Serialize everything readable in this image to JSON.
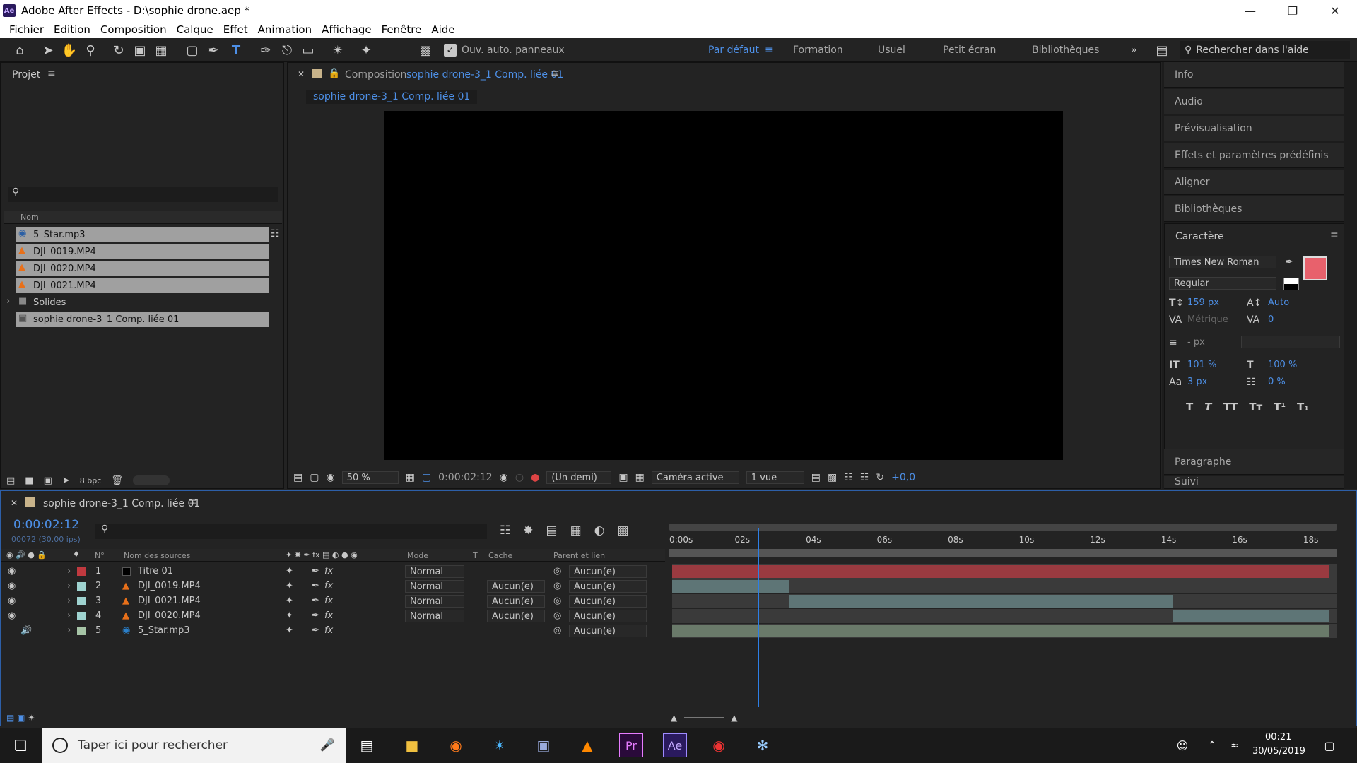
{
  "window": {
    "title": "Adobe After Effects - D:\\sophie drone.aep *",
    "app_icon": "Ae"
  },
  "menu": [
    "Fichier",
    "Edition",
    "Composition",
    "Calque",
    "Effet",
    "Animation",
    "Affichage",
    "Fenêtre",
    "Aide"
  ],
  "toolbar": {
    "auto_open_label": "Ouv. auto. panneaux",
    "workspaces": [
      "Par défaut",
      "Formation",
      "Usuel",
      "Petit écran",
      "Bibliothèques"
    ],
    "active_workspace": "Par défaut",
    "search_placeholder": "Rechercher dans l'aide"
  },
  "project": {
    "title": "Projet",
    "column_name": "Nom",
    "items": [
      {
        "name": "5_Star.mp3",
        "icon": "audio-icon",
        "selected": true
      },
      {
        "name": "DJI_0019.MP4",
        "icon": "vlc-cone-icon",
        "selected": true
      },
      {
        "name": "DJI_0020.MP4",
        "icon": "vlc-cone-icon",
        "selected": true
      },
      {
        "name": "DJI_0021.MP4",
        "icon": "vlc-cone-icon",
        "selected": true
      },
      {
        "name": "Solides",
        "icon": "folder-icon",
        "selected": false
      },
      {
        "name": "sophie drone-3_1 Comp. liée 01",
        "icon": "composition-icon",
        "selected": true
      }
    ],
    "bpc": "8 bpc"
  },
  "composition": {
    "label": "Composition",
    "name": "sophie drone-3_1 Comp. liée 01",
    "tab": "sophie drone-3_1 Comp. liée 01",
    "zoom": "50 %",
    "timecode": "0:00:02:12",
    "resolution": "(Un demi)",
    "camera": "Caméra active",
    "views": "1 vue",
    "exposure": "+0,0"
  },
  "right_panels": [
    "Info",
    "Audio",
    "Prévisualisation",
    "Effets et paramètres prédéfinis",
    "Aligner",
    "Bibliothèques"
  ],
  "character": {
    "title": "Caractère",
    "font": "Times New Roman",
    "style": "Regular",
    "size": "159 px",
    "leading": "Auto",
    "kerning": "Métrique",
    "tracking": "0",
    "line_spacing": "- px",
    "vscale": "101 %",
    "hscale": "100 %",
    "baseline": "3 px",
    "tsume": "0 %",
    "fill_color": "#e8616c",
    "style_buttons": [
      "T",
      "T",
      "TT",
      "Tт",
      "T¹",
      "T₁"
    ]
  },
  "paragraph_title": "Paragraphe",
  "suivi_title": "Suivi",
  "timeline": {
    "comp_name": "sophie drone-3_1 Comp. liée 01",
    "timecode": "0:00:02:12",
    "frames": "00072 (30.00 ips)",
    "headers": {
      "num": "N°",
      "source": "Nom des sources",
      "mode": "Mode",
      "t": "T",
      "cache": "Cache",
      "parent": "Parent et lien"
    },
    "ruler": [
      "0:00s",
      "02s",
      "04s",
      "06s",
      "08s",
      "10s",
      "12s",
      "14s",
      "16s",
      "18s"
    ],
    "playhead_seconds": 2.4,
    "duration_seconds": 18.7,
    "layers": [
      {
        "num": "1",
        "name": "Titre 01",
        "label_color": "#c0393f",
        "type": "text",
        "mode": "Normal",
        "cache": "",
        "parent": "Aucun(e)",
        "bar_color": "#9a3a40",
        "start": 0,
        "end": 18.5
      },
      {
        "num": "2",
        "name": "DJI_0019.MP4",
        "label_color": "#9fd3d0",
        "type": "video",
        "mode": "Normal",
        "cache": "Aucun(e)",
        "parent": "Aucun(e)",
        "bar_color": "#5e7576",
        "start": 0,
        "end": 3.3
      },
      {
        "num": "3",
        "name": "DJI_0021.MP4",
        "label_color": "#9fd3d0",
        "type": "video",
        "mode": "Normal",
        "cache": "Aucun(e)",
        "parent": "Aucun(e)",
        "bar_color": "#5e7576",
        "start": 3.3,
        "end": 14.1
      },
      {
        "num": "4",
        "name": "DJI_0020.MP4",
        "label_color": "#9fd3d0",
        "type": "video",
        "mode": "Normal",
        "cache": "Aucun(e)",
        "parent": "Aucun(e)",
        "bar_color": "#5e7576",
        "start": 14.1,
        "end": 18.5
      },
      {
        "num": "5",
        "name": "5_Star.mp3",
        "label_color": "#a6c4a6",
        "type": "audio",
        "mode": "",
        "cache": "",
        "parent": "Aucun(e)",
        "bar_color": "#6a7a6a",
        "start": 0,
        "end": 18.5
      }
    ]
  },
  "taskbar": {
    "search_placeholder": "Taper ici pour rechercher",
    "time": "00:21",
    "date": "30/05/2019"
  }
}
